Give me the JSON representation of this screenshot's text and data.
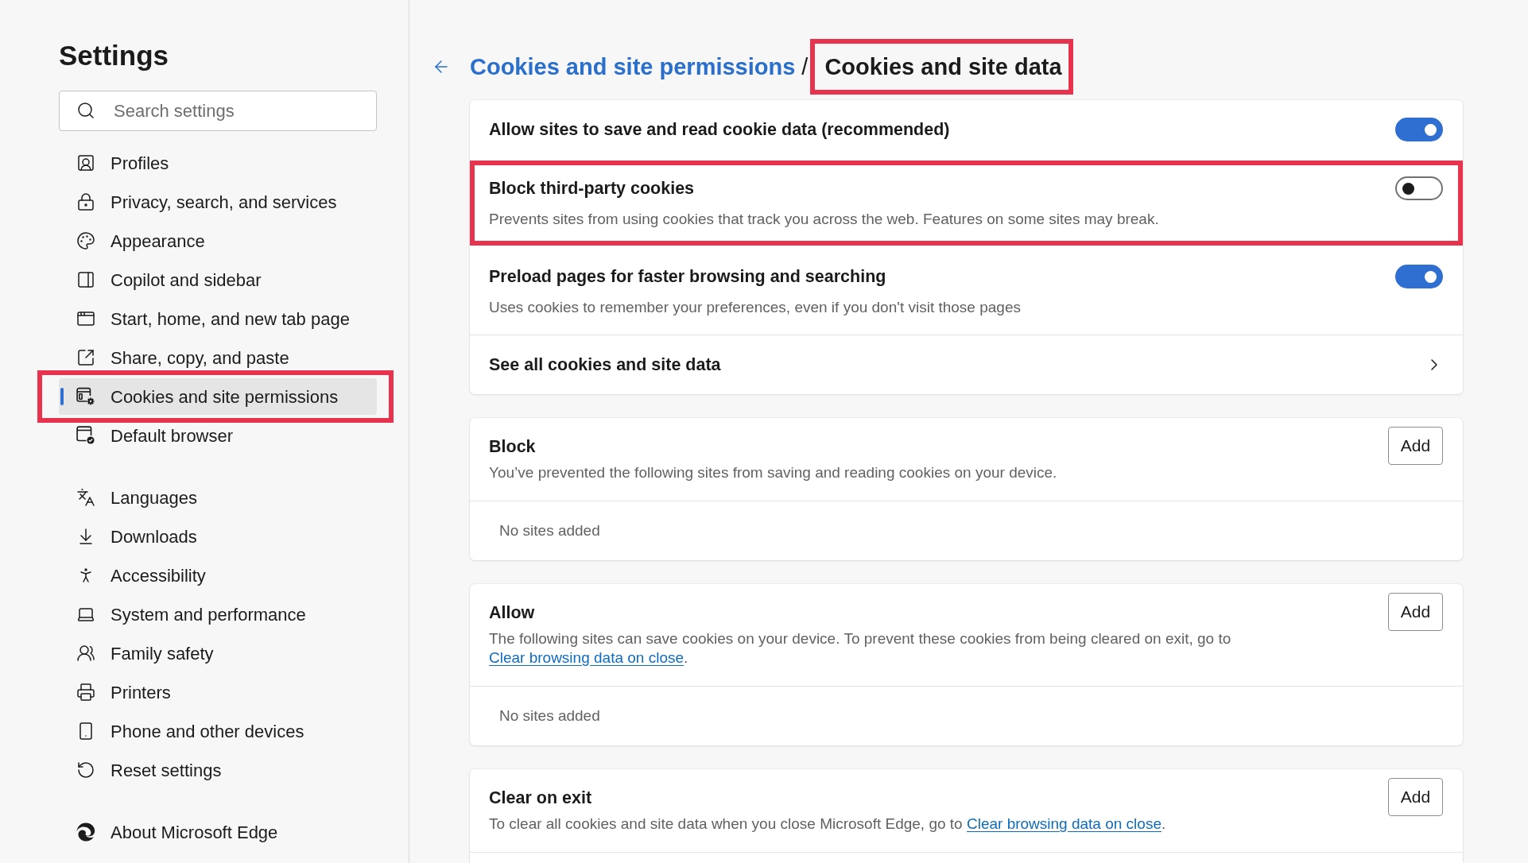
{
  "sidebar": {
    "title": "Settings",
    "search": {
      "placeholder": "Search settings"
    },
    "groups": [
      {
        "items": [
          {
            "label": "Profiles",
            "selected": false,
            "highlighted": false
          },
          {
            "label": "Privacy, search, and services",
            "selected": false,
            "highlighted": false
          },
          {
            "label": "Appearance",
            "selected": false,
            "highlighted": false
          },
          {
            "label": "Copilot and sidebar",
            "selected": false,
            "highlighted": false
          },
          {
            "label": "Start, home, and new tab page",
            "selected": false,
            "highlighted": false
          },
          {
            "label": "Share, copy, and paste",
            "selected": false,
            "highlighted": false
          },
          {
            "label": "Cookies and site permissions",
            "selected": true,
            "highlighted": true
          },
          {
            "label": "Default browser",
            "selected": false,
            "highlighted": false
          }
        ]
      },
      {
        "items": [
          {
            "label": "Languages",
            "selected": false,
            "highlighted": false
          },
          {
            "label": "Downloads",
            "selected": false,
            "highlighted": false
          },
          {
            "label": "Accessibility",
            "selected": false,
            "highlighted": false
          },
          {
            "label": "System and performance",
            "selected": false,
            "highlighted": false
          },
          {
            "label": "Family safety",
            "selected": false,
            "highlighted": false
          },
          {
            "label": "Printers",
            "selected": false,
            "highlighted": false
          },
          {
            "label": "Phone and other devices",
            "selected": false,
            "highlighted": false
          },
          {
            "label": "Reset settings",
            "selected": false,
            "highlighted": false
          }
        ]
      },
      {
        "items": [
          {
            "label": "About Microsoft Edge",
            "selected": false,
            "highlighted": false
          }
        ]
      }
    ]
  },
  "header": {
    "breadcrumb": {
      "parent": "Cookies and site permissions",
      "separator": "/",
      "current": "Cookies and site data",
      "current_highlighted": true
    }
  },
  "cards": [
    {
      "kind": "settings",
      "rows": [
        {
          "kind": "toggle",
          "title": "Allow sites to save and read cookie data (recommended)",
          "on": true,
          "highlighted": false
        },
        {
          "kind": "toggle",
          "title": "Block third-party cookies",
          "description": "Prevents sites from using cookies that track you across the web. Features on some sites may break.",
          "on": false,
          "highlighted": true
        },
        {
          "kind": "toggle",
          "title": "Preload pages for faster browsing and searching",
          "description": "Uses cookies to remember your preferences, even if you don't visit those pages",
          "on": true,
          "highlighted": false
        },
        {
          "kind": "link",
          "title": "See all cookies and site data",
          "highlighted": false
        }
      ]
    },
    {
      "kind": "site_list",
      "title": "Block",
      "description": [
        {
          "kind": "text",
          "text": "You’ve prevented the following sites from saving and reading cookies on your device."
        }
      ],
      "button": "Add",
      "empty_text": "No sites added"
    },
    {
      "kind": "site_list",
      "title": "Allow",
      "description": [
        {
          "kind": "text",
          "text": "The following sites can save cookies on your device. To prevent these cookies from being cleared on exit, go to "
        },
        {
          "kind": "link",
          "text": "Clear browsing data on close"
        },
        {
          "kind": "text",
          "text": "."
        }
      ],
      "button": "Add",
      "empty_text": "No sites added"
    },
    {
      "kind": "site_list",
      "title": "Clear on exit",
      "description": [
        {
          "kind": "text",
          "text": "To clear all cookies and site data when you close Microsoft Edge, go to "
        },
        {
          "kind": "link",
          "text": "Clear browsing data on close"
        },
        {
          "kind": "text",
          "text": "."
        }
      ],
      "button": "Add"
    }
  ]
}
